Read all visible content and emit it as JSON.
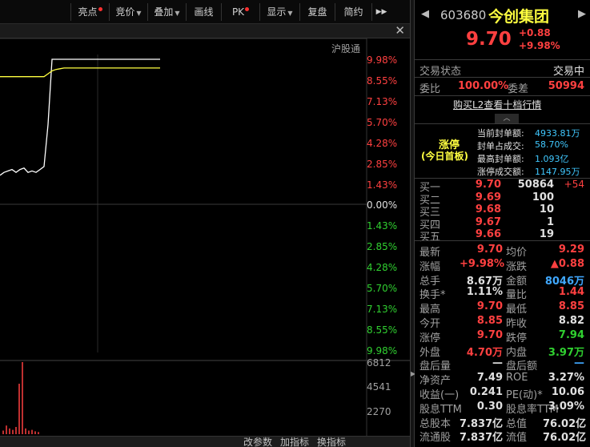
{
  "toolbar": {
    "highlight": "亮点",
    "bidding": "竞价",
    "overlay": "叠加",
    "draw": "画线",
    "pk": "PK",
    "display": "显示",
    "review": "复盘",
    "summary": "简约",
    "more": "▶▶"
  },
  "chart": {
    "hgt_label": "沪股通",
    "pct_labels_top": [
      "9.98%",
      "8.55%",
      "7.13%",
      "5.70%",
      "4.28%",
      "2.85%",
      "1.43%"
    ],
    "pct_zero": "0.00%",
    "pct_labels_bottom": [
      "1.43%",
      "2.85%",
      "4.28%",
      "5.70%",
      "7.13%",
      "8.55%",
      "9.98%"
    ],
    "vol_labels": [
      "6812",
      "4541",
      "2270"
    ],
    "price_line": [
      0.2,
      0.22,
      0.23,
      0.24,
      0.22,
      0.24,
      0.25,
      0.22,
      0.23,
      0.22,
      0.24,
      0.26,
      0.55,
      1.0,
      1.0,
      1.0,
      1.0,
      1.0,
      1.0,
      1.0,
      1.0,
      1.0,
      1.0,
      1.0,
      1.0,
      1.0,
      1.0,
      1.0,
      1.0,
      1.0,
      1.0,
      1.0,
      1.0,
      1.0,
      1.0,
      1.0,
      1.0,
      1.0,
      1.0,
      1.0,
      1.0
    ],
    "avg_line": [
      0.88,
      0.88,
      0.88,
      0.88,
      0.88,
      0.88,
      0.88,
      0.88,
      0.88,
      0.88,
      0.88,
      0.88,
      0.9,
      0.92,
      0.93,
      0.935,
      0.94,
      0.94,
      0.94,
      0.94,
      0.94,
      0.94,
      0.94,
      0.94,
      0.94,
      0.94,
      0.94,
      0.94,
      0.94,
      0.94,
      0.94,
      0.94,
      0.94,
      0.94,
      0.94,
      0.94,
      0.94,
      0.94,
      0.94,
      0.94,
      0.94
    ],
    "volumes": [
      0.05,
      0.12,
      0.08,
      0.06,
      0.1,
      0.7,
      1.0,
      0.08,
      0.05,
      0.06,
      0.04,
      0.03
    ]
  },
  "bottombar": {
    "params": "改参数",
    "add_indicator": "加指标",
    "swap_indicator": "换指标"
  },
  "header": {
    "code": "603680",
    "name": "今创集团",
    "price": "9.70",
    "change": "+0.88",
    "change_pct": "+9.98%"
  },
  "status": {
    "label": "交易状态",
    "value": "交易中",
    "ratio_label": "委比",
    "ratio_value": "100.00%",
    "diff_label": "委差",
    "diff_value": "50994",
    "l2_link": "购买L2查看十档行情"
  },
  "limit": {
    "title": "涨停",
    "subtitle": "(今日首板)",
    "rows": [
      {
        "label": "当前封单额:",
        "value": "4933.81万"
      },
      {
        "label": "封单占成交:",
        "value": "58.70%"
      },
      {
        "label": "最高封单额:",
        "value": "1.093亿"
      },
      {
        "label": "涨停成交额:",
        "value": "1147.95万"
      }
    ]
  },
  "bids": [
    {
      "label": "买一",
      "price": "9.70",
      "volume": "50864",
      "delta": "+54"
    },
    {
      "label": "买二",
      "price": "9.69",
      "volume": "100",
      "delta": ""
    },
    {
      "label": "买三",
      "price": "9.68",
      "volume": "10",
      "delta": ""
    },
    {
      "label": "买四",
      "price": "9.67",
      "volume": "1",
      "delta": ""
    },
    {
      "label": "买五",
      "price": "9.66",
      "volume": "19",
      "delta": ""
    }
  ],
  "stats": [
    {
      "l1": "最新",
      "v1": "9.70",
      "c1": "red",
      "l2": "均价",
      "v2": "9.29",
      "c2": "red"
    },
    {
      "l1": "涨幅",
      "v1": "+9.98%",
      "c1": "red",
      "l2": "涨跌",
      "v2": "▲0.88",
      "c2": "red"
    },
    {
      "l1": "总手",
      "v1": "8.67万",
      "c1": "wht",
      "l2": "金额",
      "v2": "8046万",
      "c2": "blu"
    },
    {
      "l1": "换手*",
      "v1": "1.11%",
      "c1": "wht",
      "l2": "量比",
      "v2": "1.44",
      "c2": "red"
    },
    {
      "l1": "最高",
      "v1": "9.70",
      "c1": "red",
      "l2": "最低",
      "v2": "8.85",
      "c2": "red"
    },
    {
      "l1": "今开",
      "v1": "8.85",
      "c1": "red",
      "l2": "昨收",
      "v2": "8.82",
      "c2": "wht"
    },
    {
      "l1": "涨停",
      "v1": "9.70",
      "c1": "red",
      "l2": "跌停",
      "v2": "7.94",
      "c2": "grn"
    },
    {
      "l1": "外盘",
      "v1": "4.70万",
      "c1": "red",
      "l2": "内盘",
      "v2": "3.97万",
      "c2": "grn"
    },
    {
      "l1": "盘后量",
      "v1": "—",
      "c1": "wht",
      "l2": "盘后额",
      "v2": "—",
      "c2": "blu"
    },
    {
      "l1": "净资产",
      "v1": "7.49",
      "c1": "wht",
      "l2": "ROE",
      "v2": "3.27%",
      "c2": "wht"
    },
    {
      "l1": "收益(一)",
      "v1": "0.241",
      "c1": "wht",
      "l2": "PE(动)*",
      "v2": "10.06",
      "c2": "wht"
    },
    {
      "l1": "股息TTM",
      "v1": "0.30",
      "c1": "wht",
      "l2": "股息率TTM",
      "v2": "3.09%",
      "c2": "wht"
    },
    {
      "l1": "总股本",
      "v1": "7.837亿",
      "c1": "wht",
      "l2": "总值",
      "v2": "76.02亿",
      "c2": "wht"
    },
    {
      "l1": "流通股",
      "v1": "7.837亿",
      "c1": "wht",
      "l2": "流值",
      "v2": "76.02亿",
      "c2": "wht"
    }
  ],
  "colors": {
    "up": "#ff4040",
    "down": "#30d030",
    "avg_line": "#ffff40",
    "price_line": "#ffffff",
    "volume_bar": "#ff4040"
  }
}
